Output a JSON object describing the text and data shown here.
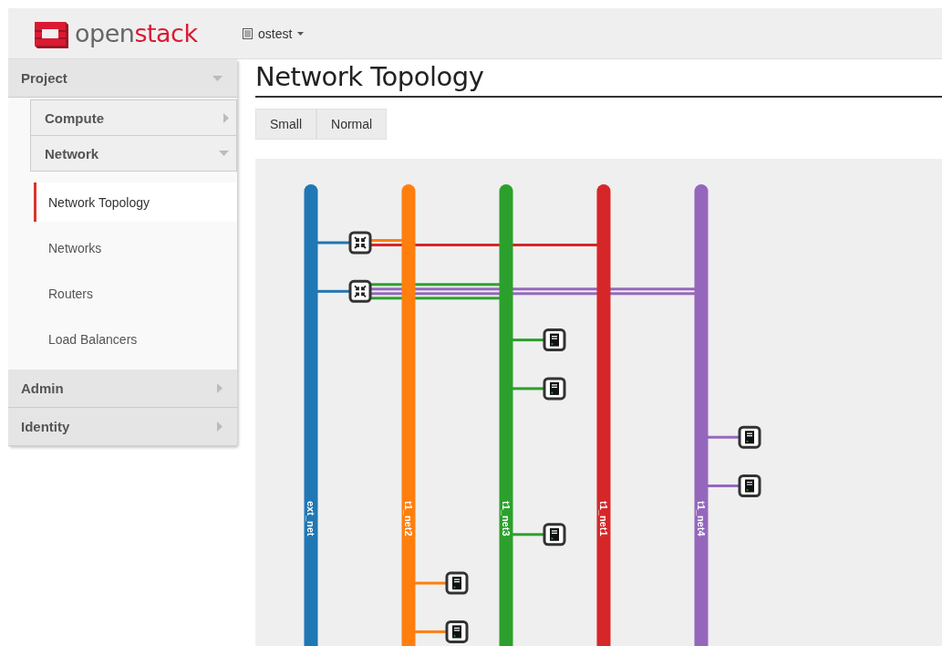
{
  "header": {
    "logo": {
      "first": "open",
      "second": "stack"
    },
    "project_menu": {
      "label": "ostest"
    }
  },
  "sidebar": {
    "sections": [
      {
        "label": "Project",
        "expanded": true,
        "groups": [
          {
            "label": "Compute",
            "expanded": false
          },
          {
            "label": "Network",
            "expanded": true,
            "items": [
              {
                "label": "Network Topology",
                "selected": true
              },
              {
                "label": "Networks",
                "selected": false
              },
              {
                "label": "Routers",
                "selected": false
              },
              {
                "label": "Load Balancers",
                "selected": false
              }
            ]
          }
        ]
      },
      {
        "label": "Admin",
        "expanded": false
      },
      {
        "label": "Identity",
        "expanded": false
      }
    ]
  },
  "page": {
    "title": "Network Topology",
    "size_buttons": [
      "Small",
      "Normal"
    ]
  },
  "topology": {
    "networks": [
      {
        "name": "ext_net",
        "color": "#1f77b4"
      },
      {
        "name": "t1_net2",
        "color": "#ff7f0e"
      },
      {
        "name": "t1_net3",
        "color": "#2ca02c"
      },
      {
        "name": "t1_net1",
        "color": "#d62728"
      },
      {
        "name": "t1_net4",
        "color": "#9467bd"
      }
    ],
    "devices": [
      {
        "kind": "router",
        "links": [
          {
            "color": "#1f77b4"
          },
          {
            "color": "#ff7f0e"
          },
          {
            "color": "#d62728"
          }
        ]
      },
      {
        "kind": "router",
        "links": [
          {
            "color": "#1f77b4"
          },
          {
            "color": "#2ca02c"
          },
          {
            "color": "#9467bd"
          },
          {
            "color": "#9467bd"
          },
          {
            "color": "#2ca02c"
          }
        ]
      },
      {
        "kind": "instance",
        "links": [
          {
            "color": "#2ca02c"
          }
        ]
      },
      {
        "kind": "instance",
        "links": [
          {
            "color": "#2ca02c"
          }
        ]
      },
      {
        "kind": "instance",
        "links": [
          {
            "color": "#9467bd"
          }
        ]
      },
      {
        "kind": "instance",
        "links": [
          {
            "color": "#9467bd"
          }
        ]
      },
      {
        "kind": "instance",
        "links": [
          {
            "color": "#2ca02c"
          }
        ]
      },
      {
        "kind": "instance",
        "links": [
          {
            "color": "#ff7f0e"
          }
        ]
      },
      {
        "kind": "instance",
        "links": [
          {
            "color": "#ff7f0e"
          }
        ]
      }
    ]
  }
}
